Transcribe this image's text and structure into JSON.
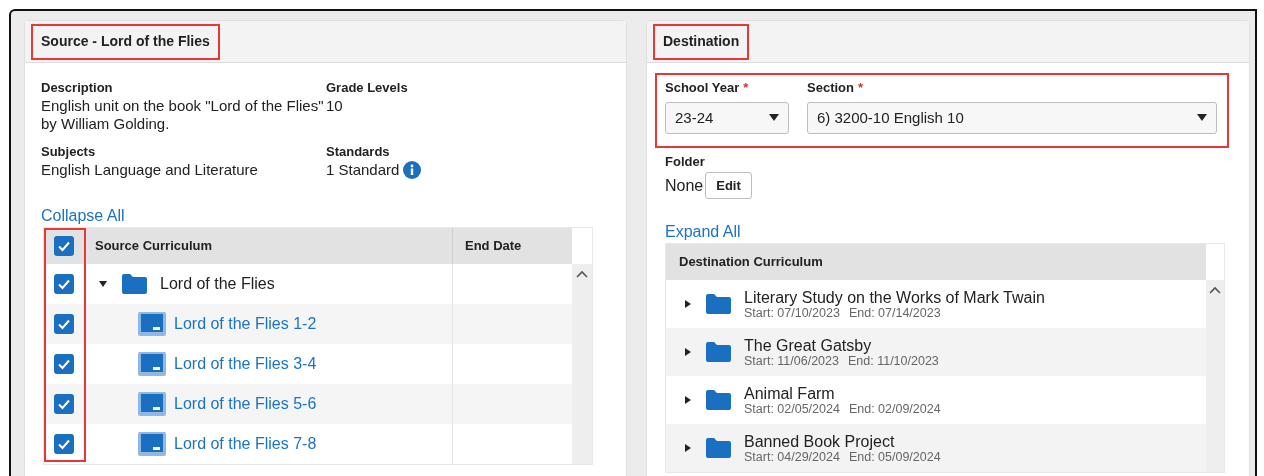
{
  "source": {
    "title": "Source - Lord of the Flies",
    "highlighted": true,
    "fields": [
      {
        "label": "Description",
        "value": "English unit on the book \"Lord of the Flies\" by William Golding.",
        "kind": "text"
      },
      {
        "label": "Grade Levels",
        "value": "10",
        "kind": "text"
      },
      {
        "label": "Subjects",
        "value": "English Language and Literature",
        "kind": "text"
      },
      {
        "label": "Standards",
        "value": "1 Standard",
        "kind": "info"
      }
    ],
    "toggle_link": "Collapse All",
    "table": {
      "columns": [
        "Source Curriculum",
        "End Date"
      ],
      "all_checked": true,
      "checkbox_column_highlighted": true,
      "rows": [
        {
          "label": "Lord of the Flies",
          "checked": true,
          "expanded": true,
          "children": [
            {
              "label": "Lord of the Flies 1-2",
              "checked": true
            },
            {
              "label": "Lord of the Flies 3-4",
              "checked": true
            },
            {
              "label": "Lord of the Flies 5-6",
              "checked": true
            },
            {
              "label": "Lord of the Flies 7-8",
              "checked": true
            }
          ]
        }
      ]
    }
  },
  "destination": {
    "title": "Destination",
    "highlighted": true,
    "selectors_highlighted": true,
    "school_year": {
      "label": "School Year",
      "required": "*",
      "value": "23-24"
    },
    "section": {
      "label": "Section",
      "required": "*",
      "value": "6) 3200-10 English 10"
    },
    "folder": {
      "label": "Folder",
      "value": "None",
      "button": "Edit"
    },
    "toggle_link": "Expand All",
    "table": {
      "columns": [
        "Destination Curriculum"
      ],
      "rows": [
        {
          "title": "Literary Study on the Works of Mark Twain",
          "start": "Start: 07/10/2023",
          "end": "End: 07/14/2023",
          "expanded": false
        },
        {
          "title": "The Great Gatsby",
          "start": "Start: 11/06/2023",
          "end": "End: 11/10/2023",
          "expanded": false
        },
        {
          "title": "Animal Farm",
          "start": "Start: 02/05/2024",
          "end": "End: 02/09/2024",
          "expanded": false
        },
        {
          "title": "Banned Book Project",
          "start": "Start: 04/29/2024",
          "end": "End: 05/09/2024",
          "expanded": false
        }
      ]
    }
  }
}
